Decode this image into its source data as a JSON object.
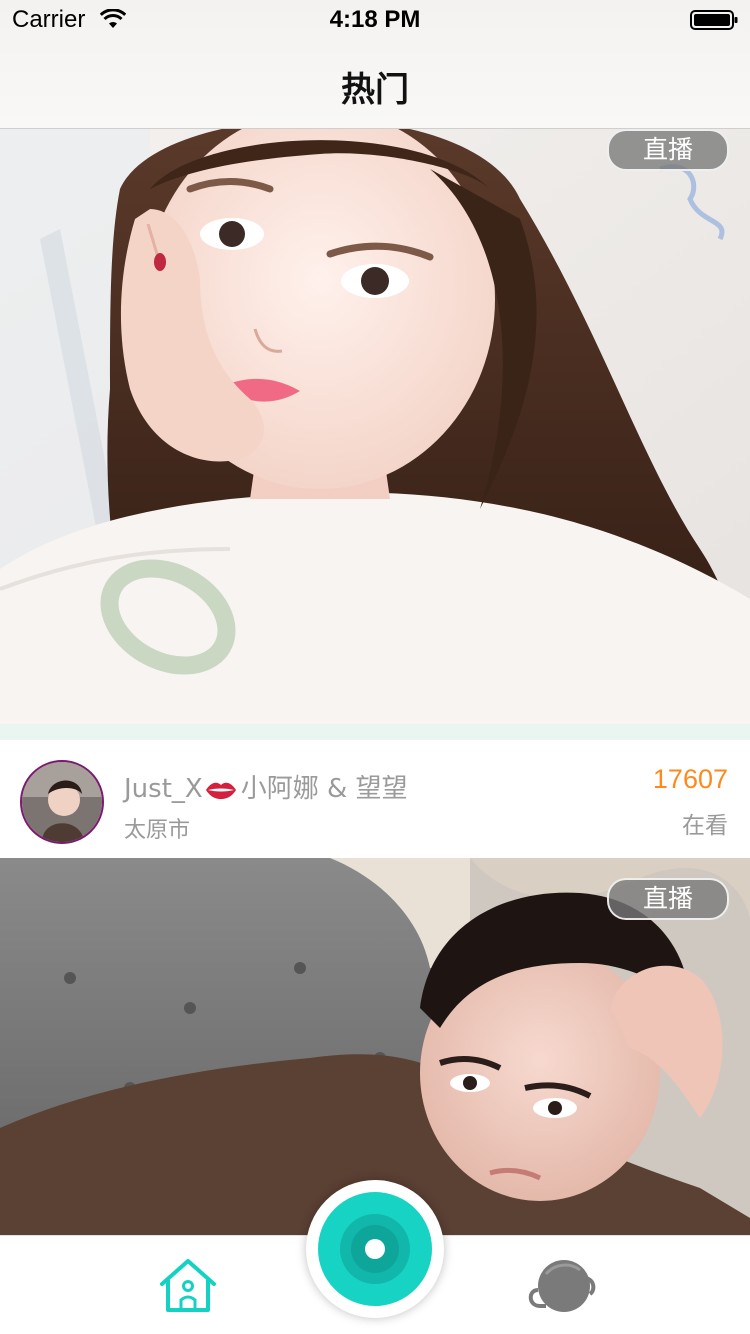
{
  "status_bar": {
    "carrier": "Carrier",
    "time": "4:18 PM"
  },
  "nav": {
    "title": "热门"
  },
  "feed": [
    {
      "badge": "直播",
      "name_part1": "Just_X",
      "name_part2": "小阿娜 & 望望",
      "city": "太原市",
      "viewers": "17607",
      "viewer_label": "在看"
    },
    {
      "badge": "直播"
    }
  ],
  "tab_bar": {
    "items": [
      "home-icon",
      "camera-record-icon",
      "profile-icon"
    ],
    "accent_color": "#14d2c3"
  },
  "colors": {
    "viewer_count": "#ff8a1c",
    "secondary_text": "#9a9a9a",
    "accent": "#14d2c3"
  }
}
